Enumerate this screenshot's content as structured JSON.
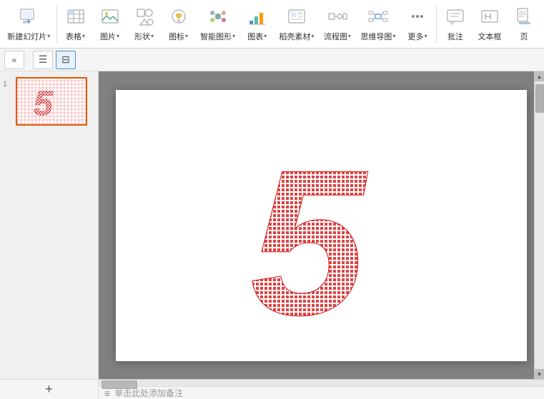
{
  "toolbar": {
    "items": [
      {
        "id": "new-slide",
        "icon": "🖼",
        "label": "新建幻灯片",
        "arrow": true
      },
      {
        "id": "table",
        "icon": "⊞",
        "label": "表格",
        "arrow": true
      },
      {
        "id": "image",
        "icon": "🖼",
        "label": "图片",
        "arrow": true
      },
      {
        "id": "shape",
        "icon": "◯",
        "label": "形状",
        "arrow": true
      },
      {
        "id": "icon",
        "icon": "☺",
        "label": "图标",
        "arrow": true
      },
      {
        "id": "smart",
        "icon": "⬡",
        "label": "智能图形",
        "arrow": true
      },
      {
        "id": "chart",
        "icon": "📊",
        "label": "图表",
        "arrow": true
      },
      {
        "id": "stock",
        "icon": "🖼",
        "label": "稻壳素材",
        "arrow": true
      },
      {
        "id": "flow",
        "icon": "⬭",
        "label": "流程图",
        "arrow": true
      },
      {
        "id": "mind",
        "icon": "🧠",
        "label": "思维导图",
        "arrow": true
      },
      {
        "id": "more",
        "icon": "···",
        "label": "更多",
        "arrow": true
      },
      {
        "id": "comment",
        "icon": "💬",
        "label": "批注",
        "arrow": false
      },
      {
        "id": "textbox",
        "icon": "⬜",
        "label": "文本框",
        "arrow": false
      },
      {
        "id": "page",
        "icon": "📄",
        "label": "页",
        "arrow": false
      }
    ]
  },
  "secondBar": {
    "collapseLabel": "«",
    "listViewLabel": "☰",
    "gridViewLabel": "⊟"
  },
  "slidePanel": {
    "slides": [
      {
        "number": "1",
        "content": "5"
      }
    ]
  },
  "canvas": {
    "mainCharacter": "5"
  },
  "bottomBar": {
    "addSlideLabel": "+",
    "noteIcon": "≡",
    "notePlaceholder": "单击此处添加备注"
  }
}
